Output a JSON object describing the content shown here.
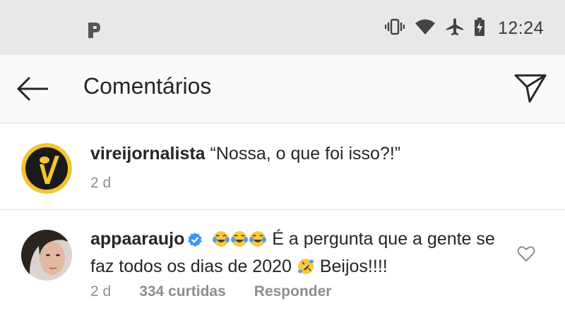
{
  "status_bar": {
    "time": "12:24",
    "icons": [
      "app-logo-icon",
      "vibrate-icon",
      "wifi-icon",
      "airplane-icon",
      "battery-charging-icon"
    ]
  },
  "header": {
    "title": "Comentários",
    "back_icon": "arrow-left-icon",
    "send_icon": "paper-plane-icon"
  },
  "comments": [
    {
      "username": "vireijornalista",
      "text": "“Nossa, o que foi isso?!”",
      "time": "2 d",
      "avatar": "vireijornalista-logo"
    },
    {
      "username": "appaaraujo",
      "verified": true,
      "emojis_before": [
        "face-with-tears-of-joy",
        "face-with-tears-of-joy",
        "face-with-tears-of-joy"
      ],
      "text_part1": "É a pergunta que a gente se faz todos os dias de 2020",
      "emoji_inline": "rolling-on-the-floor-laughing",
      "text_part2": "Beijos!!!!",
      "time": "2 d",
      "likes": "334 curtidas",
      "reply": "Responder"
    }
  ],
  "colors": {
    "status_bg": "#e8e8e8",
    "header_bg": "#fafafa",
    "text": "#262626",
    "meta": "#8e8e8e",
    "verified_blue": "#3897f0"
  }
}
